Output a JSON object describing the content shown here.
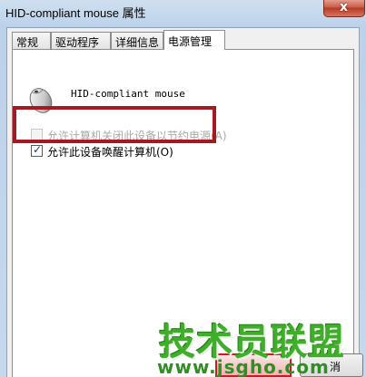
{
  "window": {
    "title": "HID-compliant mouse 属性",
    "close_glyph": "x"
  },
  "tabs": [
    {
      "label": "常规"
    },
    {
      "label": "驱动程序"
    },
    {
      "label": "详细信息"
    },
    {
      "label": "电源管理",
      "active": true
    }
  ],
  "device": {
    "name": "HID-compliant mouse",
    "icon": "mouse-icon"
  },
  "options": [
    {
      "label": "允许计算机关闭此设备以节约电源(A)",
      "checked": false,
      "disabled": true
    },
    {
      "label": "允许此设备唤醒计算机(O)",
      "checked": true,
      "disabled": false
    }
  ],
  "buttons": {
    "cancel_label": "消"
  },
  "watermark": {
    "text": "技术员联盟",
    "url": "www.jsgho.com"
  },
  "colors": {
    "highlight": "#a31a22",
    "watermark": "#3fae2a"
  }
}
